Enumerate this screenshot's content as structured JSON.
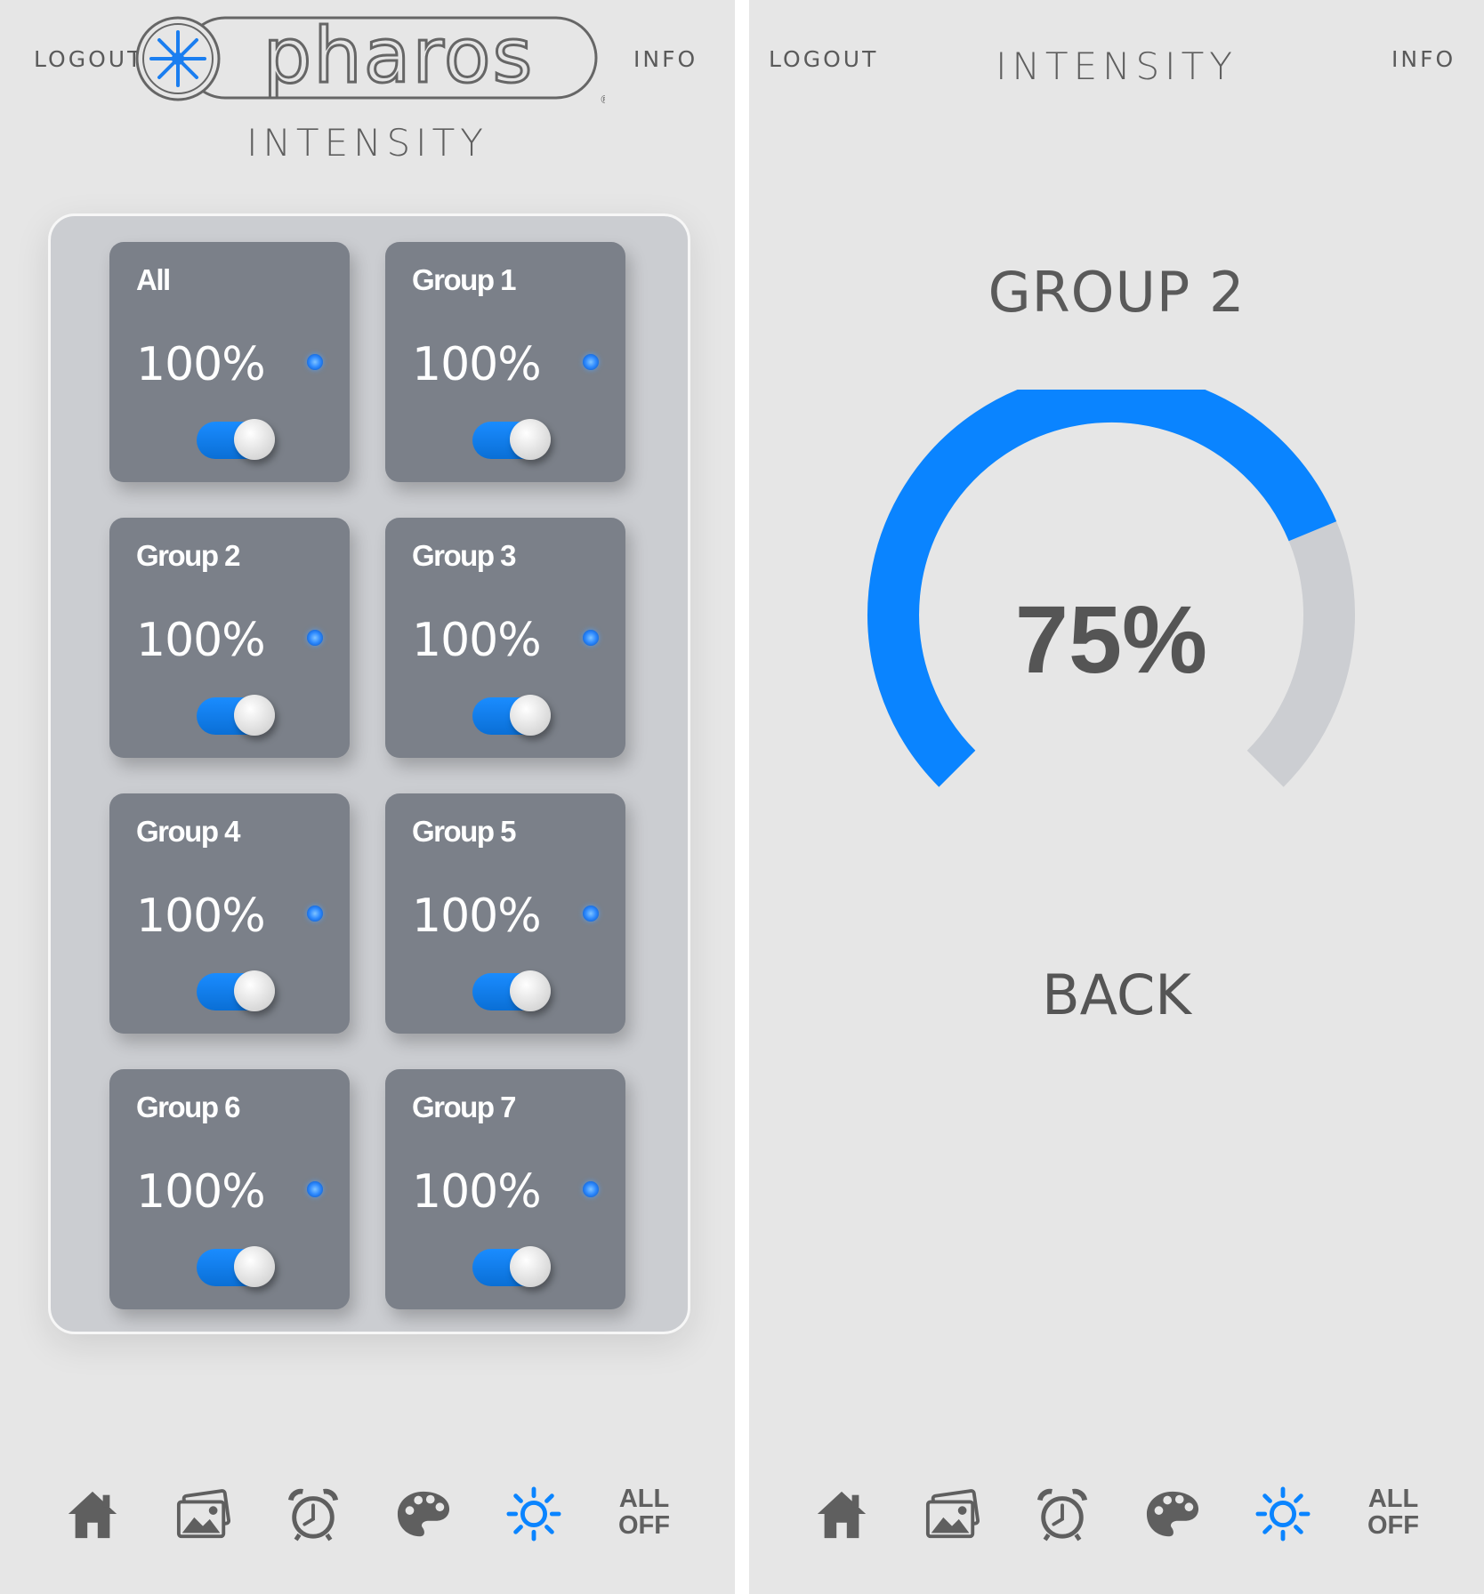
{
  "brand": "pharos",
  "colors": {
    "accent": "#0a84ff",
    "track": "#ccced2",
    "card": "#7b8089",
    "panel": "#cbcdd1",
    "background": "#e6e6e6"
  },
  "header": {
    "logout": "LOGOUT",
    "info": "INFO",
    "title": "INTENSITY",
    "registered": "®"
  },
  "groups": [
    {
      "name": "All",
      "intensity": "100%",
      "on": true
    },
    {
      "name": "Group 1",
      "intensity": "100%",
      "on": true
    },
    {
      "name": "Group 2",
      "intensity": "100%",
      "on": true
    },
    {
      "name": "Group 3",
      "intensity": "100%",
      "on": true
    },
    {
      "name": "Group 4",
      "intensity": "100%",
      "on": true
    },
    {
      "name": "Group 5",
      "intensity": "100%",
      "on": true
    },
    {
      "name": "Group 6",
      "intensity": "100%",
      "on": true
    },
    {
      "name": "Group 7",
      "intensity": "100%",
      "on": true
    }
  ],
  "detail": {
    "group_title": "GROUP 2",
    "intensity_label": "75%",
    "intensity_value": 0.75,
    "back": "BACK"
  },
  "nav": {
    "items": [
      {
        "icon": "home-icon"
      },
      {
        "icon": "gallery-icon"
      },
      {
        "icon": "alarm-clock-icon"
      },
      {
        "icon": "palette-icon"
      },
      {
        "icon": "brightness-icon",
        "active": true
      }
    ],
    "all_off_line1": "ALL",
    "all_off_line2": "OFF"
  }
}
